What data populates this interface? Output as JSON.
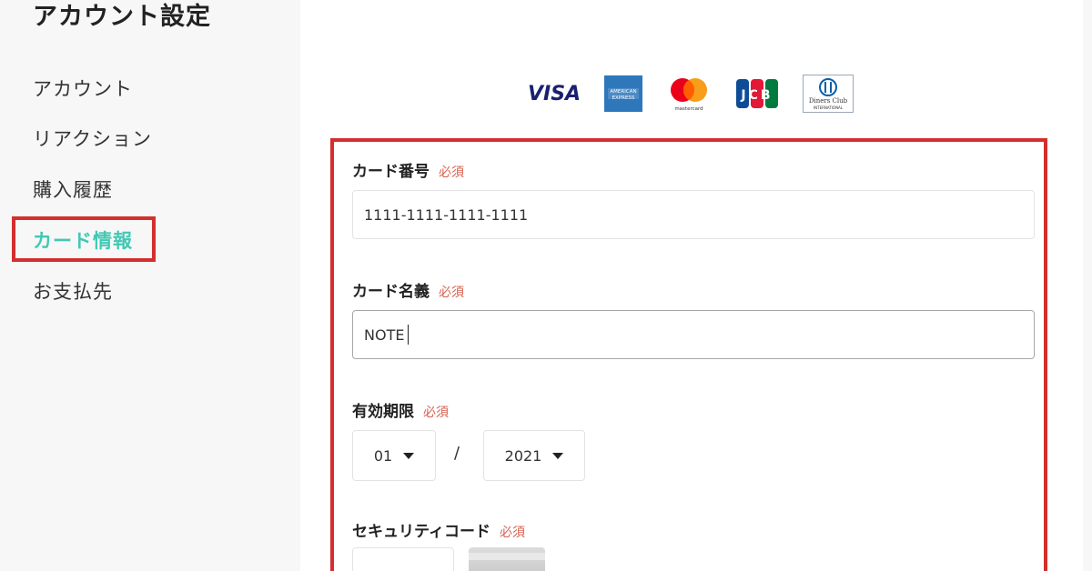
{
  "sidebar": {
    "title": "アカウント設定",
    "items": [
      {
        "label": "アカウント"
      },
      {
        "label": "リアクション"
      },
      {
        "label": "購入履歴"
      },
      {
        "label": "カード情報"
      },
      {
        "label": "お支払先"
      }
    ]
  },
  "card_logos": {
    "visa": "VISA",
    "amex_line1": "AMERICAN",
    "amex_line2": "EXPRESS",
    "mastercard": "mastercard",
    "jcb": "JCB",
    "diners_line1": "Diners Club",
    "diners_line2": "INTERNATIONAL"
  },
  "form": {
    "required_label": "必須",
    "card_number": {
      "label": "カード番号",
      "value": "1111-1111-1111-1111"
    },
    "card_name": {
      "label": "カード名義",
      "value": "NOTE"
    },
    "expiry": {
      "label": "有効期限",
      "month": "01",
      "separator": "/",
      "year": "2021"
    },
    "security_code": {
      "label": "セキュリティコード"
    }
  },
  "colors": {
    "accent": "#41c9b4",
    "highlight_border": "#d32f2f",
    "required": "#d6604f"
  }
}
